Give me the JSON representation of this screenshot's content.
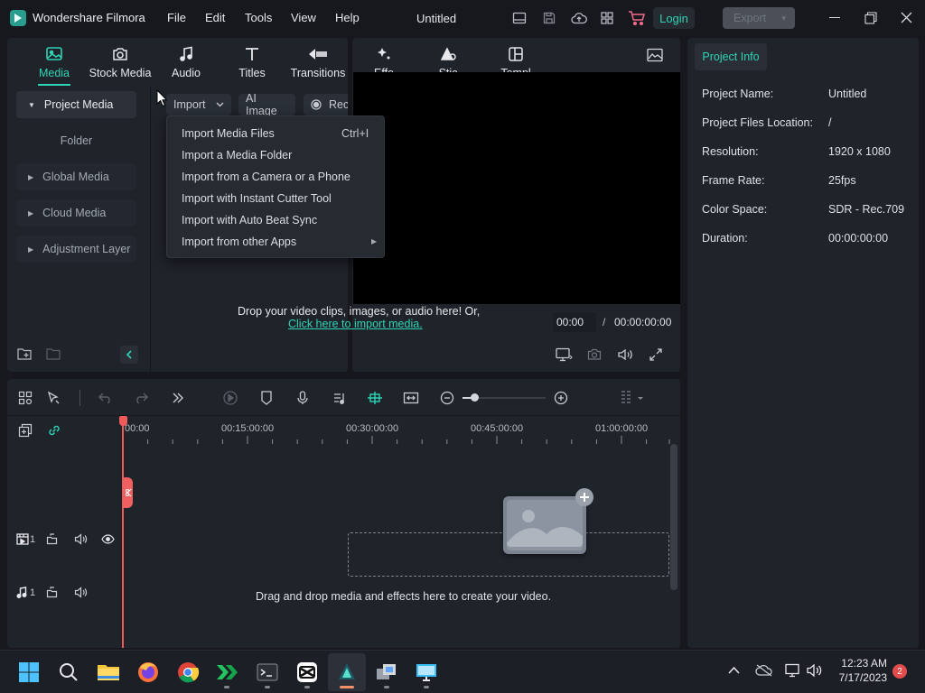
{
  "app": {
    "name": "Wondershare Filmora",
    "doc_title": "Untitled",
    "login": "Login",
    "export": "Export"
  },
  "menu": [
    "File",
    "Edit",
    "Tools",
    "View",
    "Help"
  ],
  "tabs": [
    {
      "label": "Media",
      "icon": "media-icon",
      "active": true
    },
    {
      "label": "Stock Media",
      "icon": "stock-media-icon"
    },
    {
      "label": "Audio",
      "icon": "music-note-icon"
    },
    {
      "label": "Titles",
      "icon": "titles-icon"
    },
    {
      "label": "Transitions",
      "icon": "transitions-icon"
    },
    {
      "label": "Effe",
      "icon": "effects-icon"
    },
    {
      "label": "Stic",
      "icon": "stickers-icon"
    },
    {
      "label": "Templ",
      "icon": "templates-icon"
    }
  ],
  "sidebar": {
    "items": [
      {
        "label": "Project Media",
        "active": true
      },
      {
        "label": "Folder"
      },
      {
        "label": "Global Media"
      },
      {
        "label": "Cloud Media"
      },
      {
        "label": "Adjustment Layer"
      }
    ]
  },
  "media_toolbar": {
    "import": "Import",
    "ai_image": "AI Image",
    "record": "Rec"
  },
  "import_menu": [
    {
      "label": "Import Media Files",
      "shortcut": "Ctrl+I"
    },
    {
      "label": "Import a Media Folder"
    },
    {
      "label": "Import from a Camera or a Phone"
    },
    {
      "label": "Import with Instant Cutter Tool"
    },
    {
      "label": "Import with Auto Beat Sync"
    },
    {
      "label": "Import from other Apps",
      "has_submenu": true
    }
  ],
  "drop_zone": {
    "text": "Drop your video clips, images, or audio here! Or,",
    "link": "Click here to import media."
  },
  "player": {
    "current_time": "00:00",
    "separator": "/",
    "total_time": "00:00:00:00"
  },
  "project_info": {
    "tab": "Project Info",
    "rows": [
      {
        "label": "Project Name:",
        "value": "Untitled"
      },
      {
        "label": "Project Files Location:",
        "value": "/"
      },
      {
        "label": "Resolution:",
        "value": "1920 x 1080"
      },
      {
        "label": "Frame Rate:",
        "value": "25fps"
      },
      {
        "label": "Color Space:",
        "value": "SDR - Rec.709"
      },
      {
        "label": "Duration:",
        "value": "00:00:00:00"
      }
    ]
  },
  "timeline": {
    "ruler": [
      "00:00",
      "00:15:00:00",
      "00:30:00:00",
      "00:45:00:00",
      "01:00:00:00"
    ],
    "video_track": "1",
    "audio_track": "1",
    "hint": "Drag and drop media and effects here to create your video."
  },
  "taskbar": {
    "time": "12:23 AM",
    "date": "7/17/2023",
    "notifications": "2"
  },
  "colors": {
    "accent": "#2fd3b5",
    "playhead": "#f05a5a",
    "background": "#16181d",
    "panel": "#1f232a"
  }
}
